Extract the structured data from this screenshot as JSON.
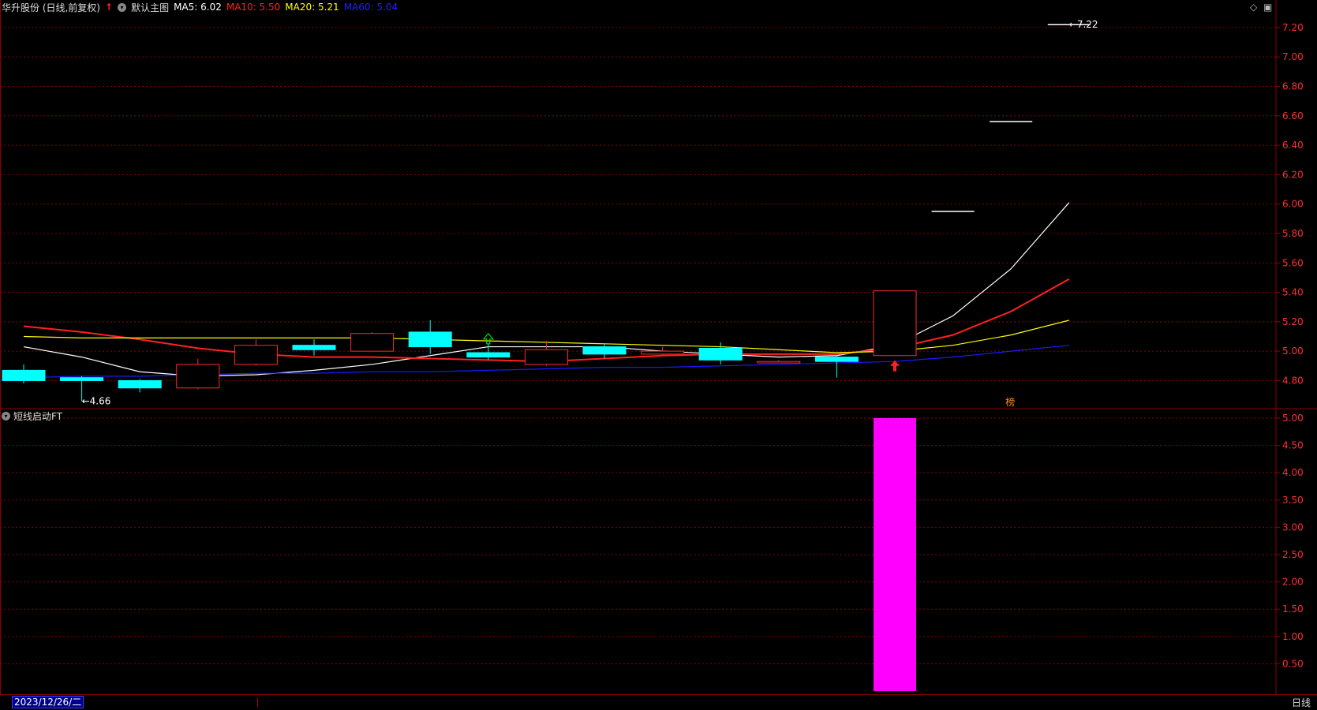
{
  "header": {
    "stock_name": "华升股份 (日线,前复权)",
    "main_label": "默认主图",
    "ma": [
      {
        "label": "MA5: 6.02",
        "color": "#ffffff"
      },
      {
        "label": "MA10: 5.50",
        "color": "#ff2020"
      },
      {
        "label": "MA20: 5.21",
        "color": "#ffff00"
      },
      {
        "label": "MA60: 5.04",
        "color": "#1a1aff"
      }
    ]
  },
  "sub_panel": {
    "title": "短线启动FT"
  },
  "footer": {
    "date": "2023/12/26/二",
    "period": "日线"
  },
  "colors": {
    "up": "#ff2a2a",
    "down": "#00ffff",
    "grid": "#8b0000",
    "axis_text": "#ff3030",
    "signal": "#ff00ff"
  },
  "chart_data": [
    {
      "type": "candlestick",
      "ylim": [
        4.62,
        7.28
      ],
      "yticks": [
        4.8,
        5.0,
        5.2,
        5.4,
        5.6,
        5.8,
        6.0,
        6.2,
        6.4,
        6.6,
        6.8,
        7.0,
        7.2
      ],
      "ytick_labels": [
        "4.80",
        "5.00",
        "5.20",
        "5.40",
        "5.60",
        "5.80",
        "6.00",
        "6.20",
        "6.40",
        "6.60",
        "6.80",
        "7.00",
        "7.20"
      ],
      "candles": [
        {
          "o": 4.87,
          "c": 4.8,
          "h": 4.91,
          "l": 4.78
        },
        {
          "o": 4.82,
          "c": 4.8,
          "h": 4.83,
          "l": 4.66
        },
        {
          "o": 4.8,
          "c": 4.75,
          "h": 4.81,
          "l": 4.72
        },
        {
          "o": 4.75,
          "c": 4.91,
          "h": 4.95,
          "l": 4.74
        },
        {
          "o": 4.91,
          "c": 5.04,
          "h": 5.08,
          "l": 4.9
        },
        {
          "o": 5.04,
          "c": 5.01,
          "h": 5.08,
          "l": 4.97
        },
        {
          "o": 5.0,
          "c": 5.12,
          "h": 5.13,
          "l": 5.0
        },
        {
          "o": 5.13,
          "c": 5.03,
          "h": 5.21,
          "l": 4.98
        },
        {
          "o": 4.99,
          "c": 4.96,
          "h": 5.05,
          "l": 4.94
        },
        {
          "o": 4.91,
          "c": 5.01,
          "h": 5.07,
          "l": 4.9
        },
        {
          "o": 5.03,
          "c": 4.98,
          "h": 5.05,
          "l": 4.95
        },
        {
          "o": 4.98,
          "c": 5.0,
          "h": 5.03,
          "l": 4.97
        },
        {
          "o": 5.02,
          "c": 4.94,
          "h": 5.06,
          "l": 4.91
        },
        {
          "o": 4.92,
          "c": 4.93,
          "h": 4.94,
          "l": 4.92
        },
        {
          "o": 4.96,
          "c": 4.93,
          "h": 4.97,
          "l": 4.82
        },
        {
          "o": 4.97,
          "c": 5.41,
          "h": 5.41,
          "l": 4.97
        },
        {
          "o": 5.95,
          "c": 5.95,
          "h": 5.95,
          "l": 5.95
        },
        {
          "o": 6.56,
          "c": 6.56,
          "h": 6.56,
          "l": 6.56
        },
        {
          "o": 7.22,
          "c": 7.22,
          "h": 7.22,
          "l": 7.22
        }
      ],
      "series": [
        {
          "name": "MA5",
          "color": "#ffffff",
          "values": [
            5.03,
            4.96,
            4.86,
            4.83,
            4.84,
            4.87,
            4.91,
            4.97,
            5.03,
            5.03,
            5.03,
            5.0,
            4.98,
            4.96,
            4.97,
            5.04,
            5.24,
            5.56,
            6.01
          ]
        },
        {
          "name": "MA10",
          "color": "#ff2020",
          "values": [
            5.17,
            5.13,
            5.08,
            5.02,
            4.98,
            4.96,
            4.96,
            4.95,
            4.94,
            4.93,
            4.95,
            4.97,
            4.98,
            4.98,
            4.98,
            5.02,
            5.11,
            5.27,
            5.49
          ]
        },
        {
          "name": "MA20",
          "color": "#ffff00",
          "values": [
            5.1,
            5.09,
            5.09,
            5.09,
            5.09,
            5.09,
            5.09,
            5.08,
            5.07,
            5.06,
            5.05,
            5.04,
            5.03,
            5.01,
            4.99,
            5.0,
            5.04,
            5.11,
            5.21
          ]
        },
        {
          "name": "MA60",
          "color": "#1a1aff",
          "values": [
            4.82,
            4.83,
            4.83,
            4.84,
            4.85,
            4.85,
            4.86,
            4.86,
            4.87,
            4.88,
            4.89,
            4.89,
            4.9,
            4.91,
            4.92,
            4.93,
            4.96,
            5.0,
            5.04
          ]
        }
      ],
      "annotations": [
        {
          "text": "4.66",
          "candle": 1,
          "value": 4.66
        },
        {
          "text": "7.22",
          "candle": 18,
          "value": 7.22
        }
      ],
      "signals": [
        {
          "type": "up-arrow",
          "candle": 15,
          "color": "#ff2020"
        },
        {
          "type": "up-arrow-outline",
          "candle": 8,
          "color": "#00ff00"
        },
        {
          "type": "marker",
          "text": "榜",
          "candle": 17,
          "color": "#ff8c00"
        }
      ]
    },
    {
      "type": "bar",
      "title": "短线启动FT",
      "ylim": [
        0,
        5.0
      ],
      "yticks": [
        0.5,
        1.0,
        1.5,
        2.0,
        2.5,
        3.0,
        3.5,
        4.0,
        4.5,
        5.0
      ],
      "ytick_labels": [
        "0.50",
        "1.00",
        "1.50",
        "2.00",
        "2.50",
        "3.00",
        "3.50",
        "4.00",
        "4.50",
        "5.00"
      ],
      "values": [
        0,
        0,
        0,
        0,
        0,
        0,
        0,
        0,
        0,
        0,
        0,
        0,
        0,
        0,
        0,
        5,
        0,
        0,
        0
      ],
      "color": "#ff00ff"
    }
  ]
}
